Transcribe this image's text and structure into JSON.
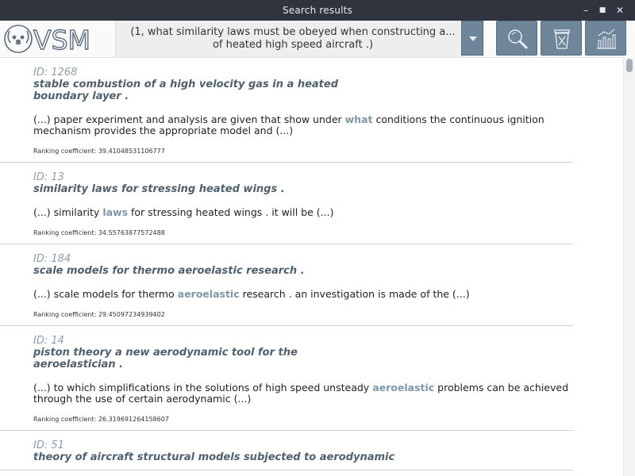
{
  "window": {
    "title": "Search results",
    "minimize": "–",
    "maximize": "■",
    "close": "✕"
  },
  "logo": {
    "text": "VSM",
    "icon": "dog-face-icon"
  },
  "query": {
    "text": "(1, what similarity laws must be obeyed when constructing a...\nof heated high speed aircraft .)",
    "dropdown_icon": "chevron-down-icon"
  },
  "toolbar": {
    "buttons": [
      "search-zoom-icon",
      "trash-icon",
      "bar-chart-icon"
    ]
  },
  "colors": {
    "accent": "#6f8599",
    "highlight": "#7f97ab",
    "title_text": "#50606e",
    "id_text": "#8a9dae",
    "titlebar": "#2f343f"
  },
  "results": [
    {
      "id": "ID: 1268",
      "title": "stable combustion of a high velocity gas in a heated boundary layer .",
      "snippet_before": "(...) paper  experiment and analysis are given that show under ",
      "snippet_highlight": "what",
      "snippet_after": " conditions the continuous ignition mechanism provides the appropriate model and (...)",
      "ranking": "Ranking coefficient: 39.41048531106777"
    },
    {
      "id": "ID: 13",
      "title": "similarity laws for stressing heated wings .",
      "snippet_before": "(...)  similarity ",
      "snippet_highlight": "laws",
      "snippet_after": " for stressing heated wings .   it will be (...)",
      "ranking": "Ranking coefficient: 34.55763877572488"
    },
    {
      "id": "ID: 184",
      "title": "scale models for thermo aeroelastic research .",
      "snippet_before": "(...)  scale models for thermo ",
      "snippet_highlight": "aeroelastic",
      "snippet_after": " research .   an investigation is made of the (...)",
      "ranking": "Ranking coefficient: 29.45097234939402"
    },
    {
      "id": "ID: 14",
      "title": "piston theory   a new aerodynamic tool for the aeroelastician .",
      "snippet_before": "(...) to which simplifications in the solutions of high speed unsteady ",
      "snippet_highlight": "aeroelastic",
      "snippet_after": " problems can be achieved through the use of certain aerodynamic (...)",
      "ranking": "Ranking coefficient: 26.319691264158607"
    },
    {
      "id": "ID: 51",
      "title": "theory of aircraft structural models subjected to aerodynamic",
      "snippet_before": "",
      "snippet_highlight": "",
      "snippet_after": "",
      "ranking": ""
    }
  ]
}
